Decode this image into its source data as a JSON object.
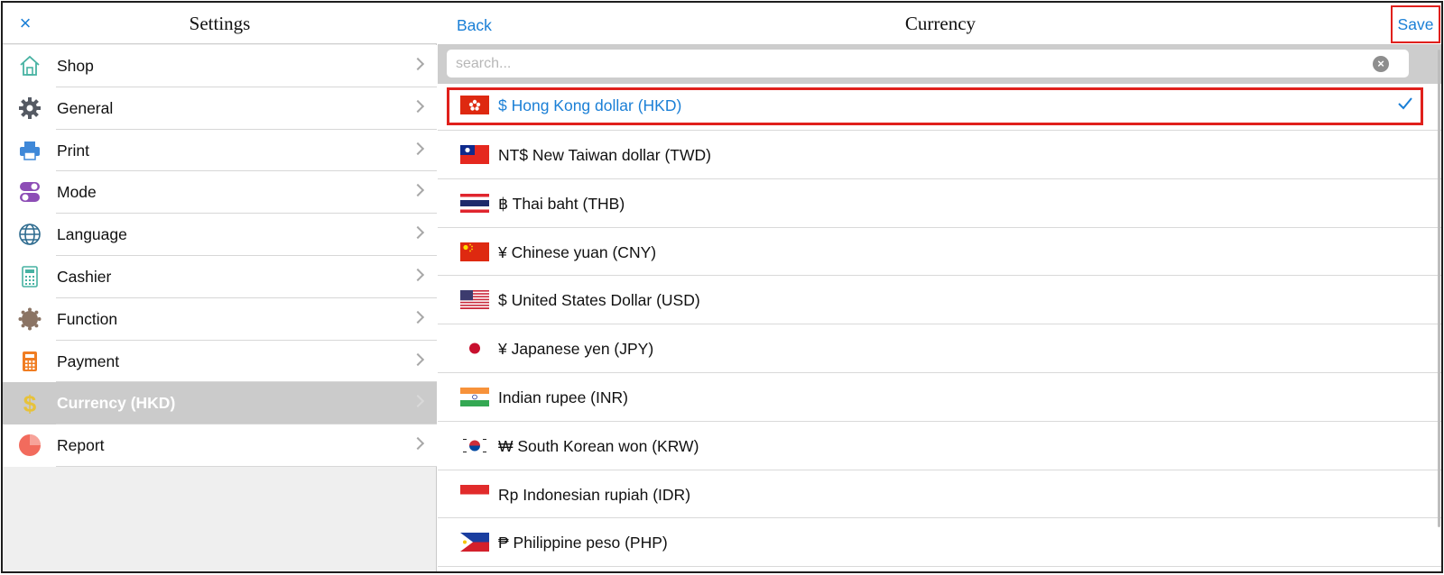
{
  "settings": {
    "title": "Settings",
    "close_icon": "×",
    "items": [
      {
        "label": "Shop",
        "icon": "shop-icon"
      },
      {
        "label": "General",
        "icon": "gear-icon"
      },
      {
        "label": "Print",
        "icon": "printer-icon"
      },
      {
        "label": "Mode",
        "icon": "toggle-icon"
      },
      {
        "label": "Language",
        "icon": "globe-icon"
      },
      {
        "label": "Cashier",
        "icon": "cashier-icon"
      },
      {
        "label": "Function",
        "icon": "function-icon"
      },
      {
        "label": "Payment",
        "icon": "calculator-icon"
      },
      {
        "label": "Currency (HKD)",
        "icon": "dollar-icon",
        "active": true
      },
      {
        "label": "Report",
        "icon": "pie-chart-icon"
      }
    ]
  },
  "currency": {
    "title": "Currency",
    "back_label": "Back",
    "save_label": "Save",
    "search_placeholder": "search...",
    "clear_icon": "×",
    "selected_index": 0,
    "options": [
      {
        "label": "$ Hong Kong dollar (HKD)",
        "flag": "hk-flag"
      },
      {
        "label": "NT$ New Taiwan dollar (TWD)",
        "flag": "tw-flag"
      },
      {
        "label": "฿ Thai baht (THB)",
        "flag": "th-flag"
      },
      {
        "label": "¥ Chinese yuan (CNY)",
        "flag": "cn-flag"
      },
      {
        "label": "$ United States Dollar (USD)",
        "flag": "us-flag"
      },
      {
        "label": "¥ Japanese yen (JPY)",
        "flag": "jp-flag"
      },
      {
        "label": "Indian rupee (INR)",
        "flag": "in-flag"
      },
      {
        "label": "₩ South Korean won (KRW)",
        "flag": "kr-flag"
      },
      {
        "label": "Rp Indonesian rupiah (IDR)",
        "flag": "id-flag"
      },
      {
        "label": "₱ Philippine peso (PHP)",
        "flag": "ph-flag"
      }
    ]
  },
  "colors": {
    "accent": "#1a7fd6",
    "highlight": "#e0201c",
    "active_menu": "#cbcbcb"
  }
}
